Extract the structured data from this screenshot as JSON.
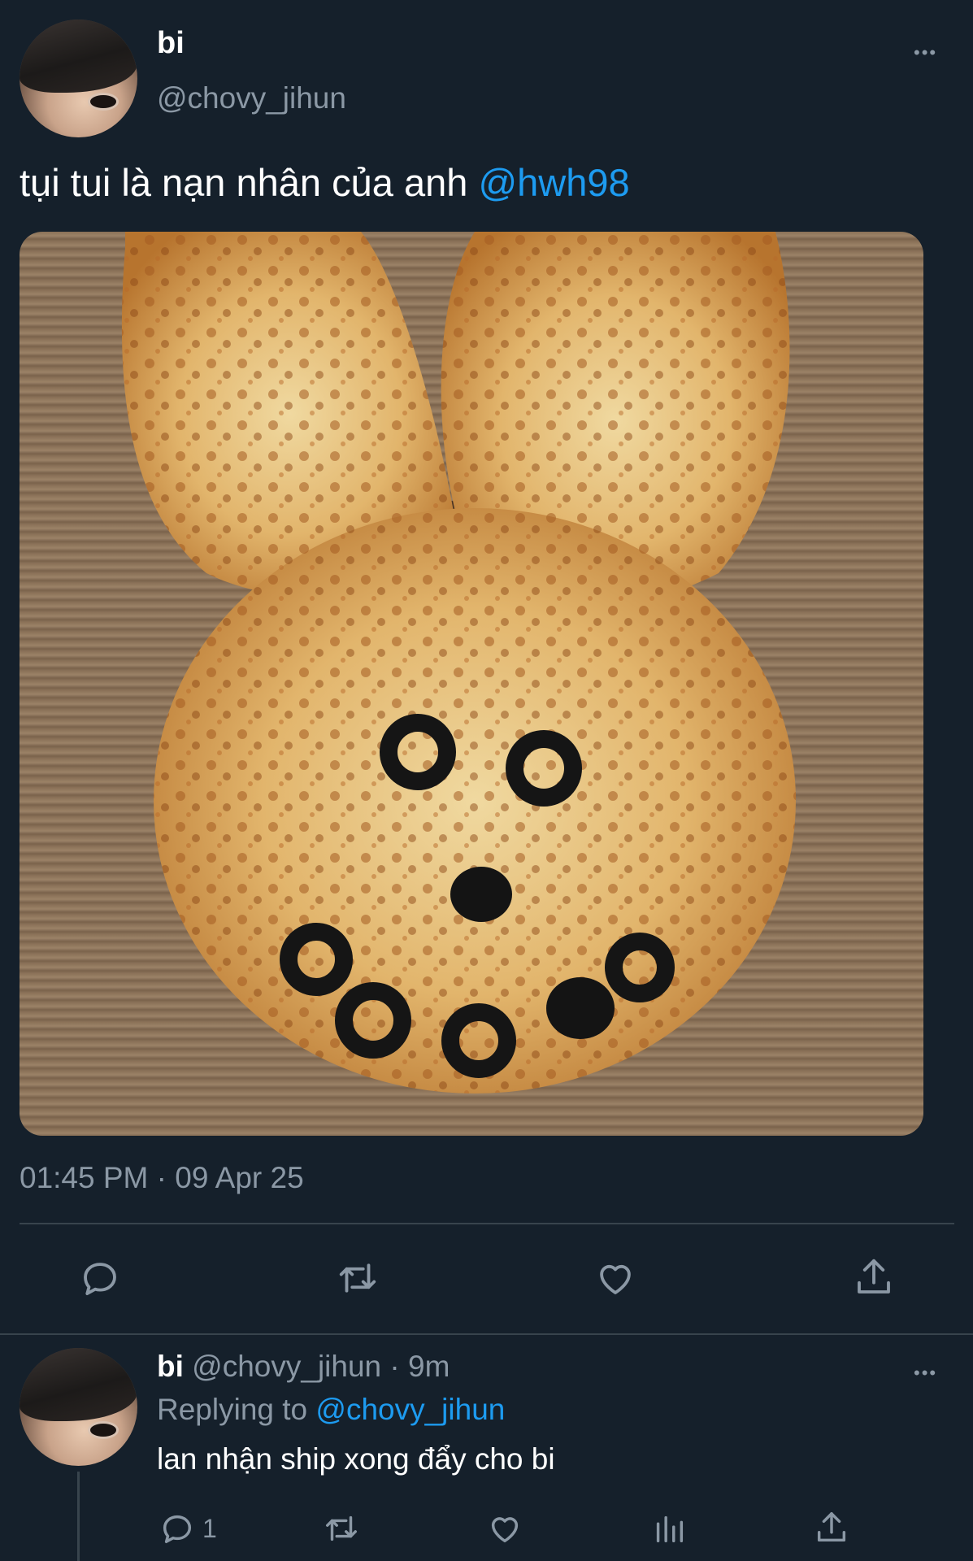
{
  "tweet": {
    "display_name": "bi",
    "handle": "@chovy_jihun",
    "text_prefix": "tụi tui là nạn nhân của anh ",
    "mention": "@hwh98",
    "timestamp": "01:45 PM · 09 Apr 25",
    "more_label": "•••",
    "image_alt": "Bunny-shaped cheese pizza with olive face",
    "actions": [
      "reply-icon",
      "retweet-icon",
      "like-icon",
      "share-icon"
    ]
  },
  "reply": {
    "display_name": "bi",
    "handle": "@chovy_jihun",
    "separator": "·",
    "age": "9m",
    "replying_to_label": "Replying to",
    "replying_to_handle": "@chovy_jihun",
    "text": "lan nhận ship xong đẩy cho bi",
    "more_label": "•••",
    "reply_count": "1",
    "actions": [
      "reply-icon",
      "retweet-icon",
      "like-icon",
      "views-icon",
      "share-icon"
    ]
  },
  "colors": {
    "background": "#15202b",
    "text": "#ffffff",
    "muted": "#8b98a5",
    "link": "#1d9bf0",
    "divider": "#38444d"
  }
}
